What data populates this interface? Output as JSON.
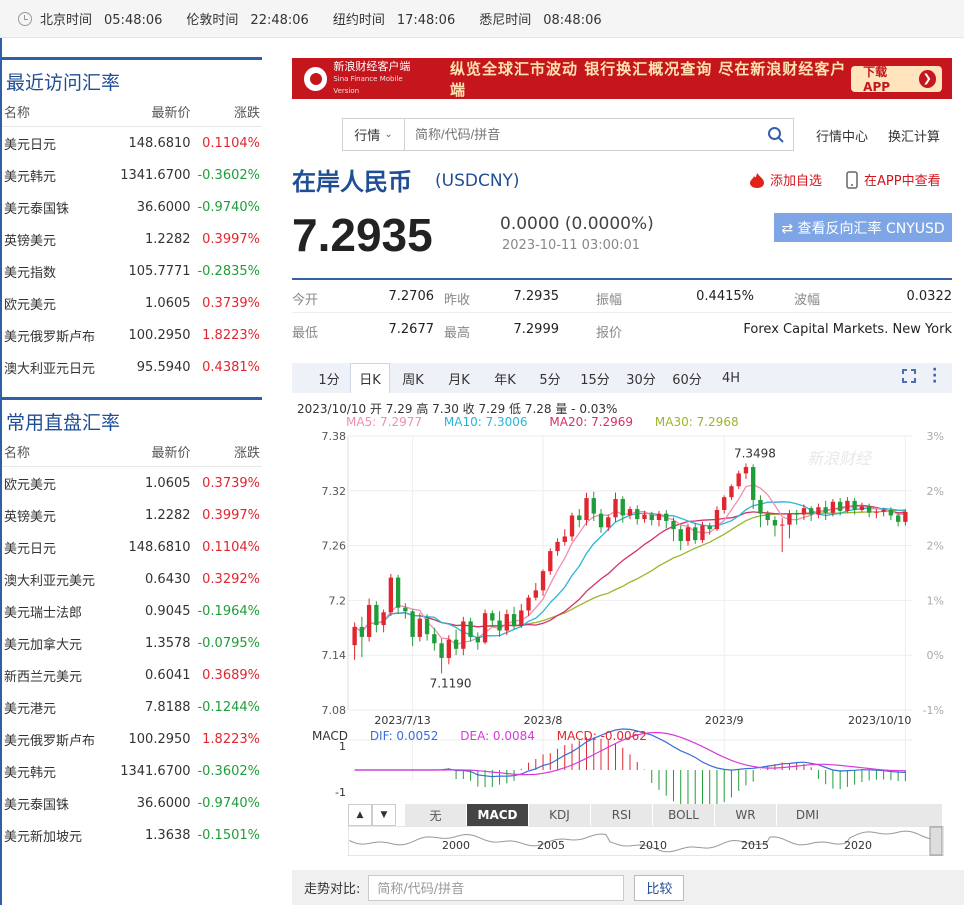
{
  "timezones": [
    {
      "city": "北京时间",
      "time": "05:48:06"
    },
    {
      "city": "伦敦时间",
      "time": "22:48:06"
    },
    {
      "city": "纽约时间",
      "time": "17:48:06"
    },
    {
      "city": "悉尼时间",
      "time": "08:48:06"
    }
  ],
  "recent": {
    "title": "最近访问汇率",
    "headers": {
      "name": "名称",
      "price": "最新价",
      "change": "涨跌"
    },
    "rows": [
      {
        "name": "美元日元",
        "price": "148.6810",
        "change": "0.1104%",
        "dir": "up"
      },
      {
        "name": "美元韩元",
        "price": "1341.6700",
        "change": "-0.3602%",
        "dir": "down"
      },
      {
        "name": "美元泰国铢",
        "price": "36.6000",
        "change": "-0.9740%",
        "dir": "down"
      },
      {
        "name": "英镑美元",
        "price": "1.2282",
        "change": "0.3997%",
        "dir": "up"
      },
      {
        "name": "美元指数",
        "price": "105.7771",
        "change": "-0.2835%",
        "dir": "down"
      },
      {
        "name": "欧元美元",
        "price": "1.0605",
        "change": "0.3739%",
        "dir": "up"
      },
      {
        "name": "美元俄罗斯卢布",
        "price": "100.2950",
        "change": "1.8223%",
        "dir": "up"
      },
      {
        "name": "澳大利亚元日元",
        "price": "95.5940",
        "change": "0.4381%",
        "dir": "up"
      }
    ]
  },
  "common": {
    "title": "常用直盘汇率",
    "headers": {
      "name": "名称",
      "price": "最新价",
      "change": "涨跌"
    },
    "rows": [
      {
        "name": "欧元美元",
        "price": "1.0605",
        "change": "0.3739%",
        "dir": "up"
      },
      {
        "name": "英镑美元",
        "price": "1.2282",
        "change": "0.3997%",
        "dir": "up"
      },
      {
        "name": "美元日元",
        "price": "148.6810",
        "change": "0.1104%",
        "dir": "up"
      },
      {
        "name": "澳大利亚元美元",
        "price": "0.6430",
        "change": "0.3292%",
        "dir": "up"
      },
      {
        "name": "美元瑞士法郎",
        "price": "0.9045",
        "change": "-0.1964%",
        "dir": "down"
      },
      {
        "name": "美元加拿大元",
        "price": "1.3578",
        "change": "-0.0795%",
        "dir": "down"
      },
      {
        "name": "新西兰元美元",
        "price": "0.6041",
        "change": "0.3689%",
        "dir": "up"
      },
      {
        "name": "美元港元",
        "price": "7.8188",
        "change": "-0.1244%",
        "dir": "down"
      },
      {
        "name": "美元俄罗斯卢布",
        "price": "100.2950",
        "change": "1.8223%",
        "dir": "up"
      },
      {
        "name": "美元韩元",
        "price": "1341.6700",
        "change": "-0.3602%",
        "dir": "down"
      },
      {
        "name": "美元泰国铢",
        "price": "36.6000",
        "change": "-0.9740%",
        "dir": "down"
      },
      {
        "name": "美元新加坡元",
        "price": "1.3638",
        "change": "-0.1501%",
        "dir": "down"
      }
    ]
  },
  "banner": {
    "brand": "新浪财经客户端",
    "brand_en": "Sina Finance Mobile Version",
    "slogan": "纵览全球汇市波动  银行换汇概况查询  尽在新浪财经客户端",
    "button": "下载APP"
  },
  "search": {
    "select": "行情",
    "placeholder": "简称/代码/拼音"
  },
  "nav": {
    "market_center": "行情中心",
    "fx_calc": "换汇计算"
  },
  "quote": {
    "name": "在岸人民币",
    "code": "(USDCNY)",
    "add_fav": "添加自选",
    "app_view": "在APP中查看",
    "price": "7.2935",
    "change": "0.0000 (0.0000%)",
    "timestamp": "2023-10-11 03:00:01",
    "reverse_btn": "⇄ 查看反向汇率 CNYUSD"
  },
  "stats": {
    "open_label": "今开",
    "open": "7.2706",
    "prev_label": "昨收",
    "prev": "7.2935",
    "amp_label": "振幅",
    "amp": "0.4415%",
    "wave_label": "波幅",
    "wave": "0.0322",
    "low_label": "最低",
    "low": "7.2677",
    "high_label": "最高",
    "high": "7.2999",
    "quote_label": "报价",
    "quote_src": "Forex Capital Markets. New York"
  },
  "tabs": [
    "1分",
    "日K",
    "周K",
    "月K",
    "年K",
    "5分",
    "15分",
    "30分",
    "60分",
    "4H"
  ],
  "active_tab": "日K",
  "kinfo": {
    "line1": "2023/10/10 开 7.29 高 7.30 收 7.29 低 7.28 量 - 0.03%",
    "ma5": "MA5: 7.2977",
    "ma10": "MA10: 7.3006",
    "ma20": "MA20: 7.2969",
    "ma30": "MA30: 7.2968"
  },
  "macd_info": {
    "label": "MACD",
    "dif": "DIF: 0.0052",
    "dea": "DEA: 0.0084",
    "macd": "MACD: -0.0062"
  },
  "indicators": [
    "无",
    "MACD",
    "KDJ",
    "RSI",
    "BOLL",
    "WR",
    "DMI"
  ],
  "compare": {
    "label": "走势对比:",
    "placeholder": "简称/代码/拼音",
    "button": "比较"
  },
  "colors": {
    "up": "#e0262f",
    "down": "#1f9d3a",
    "ma5": "#f08fb0",
    "ma10": "#29b6d6",
    "ma20": "#d6306a",
    "ma30": "#9bb52b",
    "dif": "#3a6fd8",
    "dea": "#d83ad8"
  },
  "chart_data": {
    "type": "candlestick",
    "y_ticks": [
      "7.38",
      "7.32",
      "7.26",
      "7.2",
      "7.14",
      "7.08"
    ],
    "y_range": [
      7.08,
      7.38
    ],
    "pct_ticks": [
      "3%",
      "2%",
      "2%",
      "1%",
      "0%",
      "-1%"
    ],
    "x_ticks": [
      "2023/7/13",
      "2023/8",
      "2023/9",
      "2023/10/10"
    ],
    "max_label": "7.3498",
    "min_label": "7.1190",
    "candles": [
      [
        7.151,
        7.171,
        7.135,
        7.176
      ],
      [
        7.171,
        7.16,
        7.138,
        7.182
      ],
      [
        7.16,
        7.195,
        7.155,
        7.202
      ],
      [
        7.195,
        7.173,
        7.165,
        7.199
      ],
      [
        7.173,
        7.187,
        7.165,
        7.19
      ],
      [
        7.187,
        7.225,
        7.183,
        7.229
      ],
      [
        7.225,
        7.192,
        7.185,
        7.228
      ],
      [
        7.192,
        7.188,
        7.18,
        7.197
      ],
      [
        7.188,
        7.16,
        7.15,
        7.19
      ],
      [
        7.16,
        7.18,
        7.155,
        7.186
      ],
      [
        7.18,
        7.163,
        7.156,
        7.185
      ],
      [
        7.163,
        7.153,
        7.145,
        7.17
      ],
      [
        7.153,
        7.137,
        7.12,
        7.158
      ],
      [
        7.137,
        7.157,
        7.13,
        7.162
      ],
      [
        7.157,
        7.147,
        7.14,
        7.168
      ],
      [
        7.147,
        7.177,
        7.14,
        7.182
      ],
      [
        7.177,
        7.16,
        7.155,
        7.181
      ],
      [
        7.16,
        7.154,
        7.146,
        7.165
      ],
      [
        7.154,
        7.186,
        7.152,
        7.19
      ],
      [
        7.186,
        7.178,
        7.171,
        7.189
      ],
      [
        7.178,
        7.167,
        7.16,
        7.188
      ],
      [
        7.167,
        7.185,
        7.162,
        7.19
      ],
      [
        7.185,
        7.172,
        7.168,
        7.193
      ],
      [
        7.172,
        7.189,
        7.17,
        7.196
      ],
      [
        7.189,
        7.203,
        7.183,
        7.206
      ],
      [
        7.203,
        7.211,
        7.2,
        7.219
      ],
      [
        7.211,
        7.232,
        7.205,
        7.234
      ],
      [
        7.232,
        7.254,
        7.228,
        7.257
      ],
      [
        7.254,
        7.264,
        7.249,
        7.268
      ],
      [
        7.264,
        7.27,
        7.26,
        7.278
      ],
      [
        7.27,
        7.293,
        7.265,
        7.296
      ],
      [
        7.293,
        7.288,
        7.28,
        7.3
      ],
      [
        7.288,
        7.312,
        7.282,
        7.318
      ],
      [
        7.312,
        7.295,
        7.287,
        7.319
      ],
      [
        7.295,
        7.28,
        7.274,
        7.3
      ],
      [
        7.28,
        7.291,
        7.276,
        7.294
      ],
      [
        7.291,
        7.311,
        7.286,
        7.318
      ],
      [
        7.311,
        7.293,
        7.285,
        7.314
      ],
      [
        7.293,
        7.3,
        7.289,
        7.303
      ],
      [
        7.3,
        7.289,
        7.283,
        7.304
      ],
      [
        7.289,
        7.294,
        7.285,
        7.298
      ],
      [
        7.294,
        7.288,
        7.282,
        7.297
      ],
      [
        7.288,
        7.295,
        7.281,
        7.298
      ],
      [
        7.295,
        7.287,
        7.279,
        7.299
      ],
      [
        7.287,
        7.278,
        7.265,
        7.291
      ],
      [
        7.278,
        7.265,
        7.255,
        7.282
      ],
      [
        7.265,
        7.28,
        7.26,
        7.284
      ],
      [
        7.28,
        7.266,
        7.262,
        7.285
      ],
      [
        7.266,
        7.282,
        7.263,
        7.286
      ],
      [
        7.282,
        7.278,
        7.272,
        7.285
      ],
      [
        7.278,
        7.299,
        7.276,
        7.303
      ],
      [
        7.299,
        7.313,
        7.295,
        7.315
      ],
      [
        7.313,
        7.325,
        7.31,
        7.327
      ],
      [
        7.325,
        7.339,
        7.322,
        7.342
      ],
      [
        7.339,
        7.346,
        7.333,
        7.35
      ],
      [
        7.346,
        7.31,
        7.3,
        7.349
      ],
      [
        7.31,
        7.295,
        7.28,
        7.315
      ],
      [
        7.295,
        7.288,
        7.282,
        7.298
      ],
      [
        7.288,
        7.282,
        7.27,
        7.292
      ],
      [
        7.282,
        7.283,
        7.253,
        7.29
      ],
      [
        7.283,
        7.295,
        7.268,
        7.299
      ],
      [
        7.295,
        7.294,
        7.283,
        7.299
      ],
      [
        7.294,
        7.301,
        7.288,
        7.305
      ],
      [
        7.301,
        7.294,
        7.287,
        7.303
      ],
      [
        7.294,
        7.302,
        7.29,
        7.306
      ],
      [
        7.302,
        7.296,
        7.288,
        7.309
      ],
      [
        7.296,
        7.308,
        7.292,
        7.311
      ],
      [
        7.308,
        7.298,
        7.293,
        7.312
      ],
      [
        7.298,
        7.309,
        7.296,
        7.313
      ],
      [
        7.309,
        7.299,
        7.294,
        7.312
      ],
      [
        7.299,
        7.303,
        7.297,
        7.307
      ],
      [
        7.303,
        7.296,
        7.291,
        7.306
      ],
      [
        7.296,
        7.297,
        7.29,
        7.3
      ],
      [
        7.297,
        7.299,
        7.292,
        7.301
      ],
      [
        7.299,
        7.293,
        7.288,
        7.302
      ],
      [
        7.293,
        7.286,
        7.281,
        7.296
      ],
      [
        7.286,
        7.297,
        7.282,
        7.3
      ]
    ]
  }
}
